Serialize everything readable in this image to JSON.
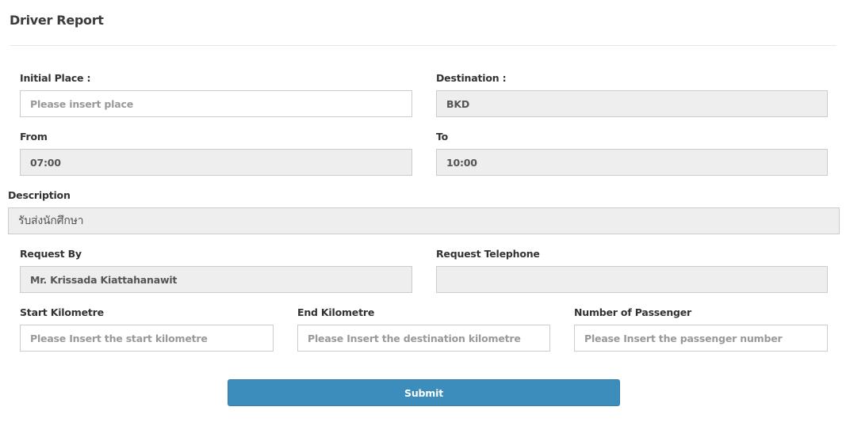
{
  "header": {
    "title": "Driver Report"
  },
  "form": {
    "initial_place": {
      "label": "Initial Place :",
      "value": "",
      "placeholder": "Please insert place"
    },
    "destination": {
      "label": "Destination :",
      "value": "BKD"
    },
    "from": {
      "label": "From",
      "value": "07:00"
    },
    "to": {
      "label": "To",
      "value": "10:00"
    },
    "description": {
      "label": "Description",
      "value": "รับส่งนักศึกษา"
    },
    "request_by": {
      "label": "Request By",
      "value": "Mr. Krissada Kiattahanawit"
    },
    "request_telephone": {
      "label": "Request Telephone",
      "value": ""
    },
    "start_kilometre": {
      "label": "Start Kilometre",
      "value": "",
      "placeholder": "Please Insert the start kilometre"
    },
    "end_kilometre": {
      "label": "End Kilometre",
      "value": "",
      "placeholder": "Please Insert the destination kilometre"
    },
    "passenger_number": {
      "label": "Number of Passenger",
      "value": "",
      "placeholder": "Please Insert the passenger number"
    },
    "submit_label": "Submit"
  },
  "colors": {
    "primary_button": "#3c8dbc",
    "readonly_background": "#eeeeee",
    "field_border": "#cccccc"
  }
}
